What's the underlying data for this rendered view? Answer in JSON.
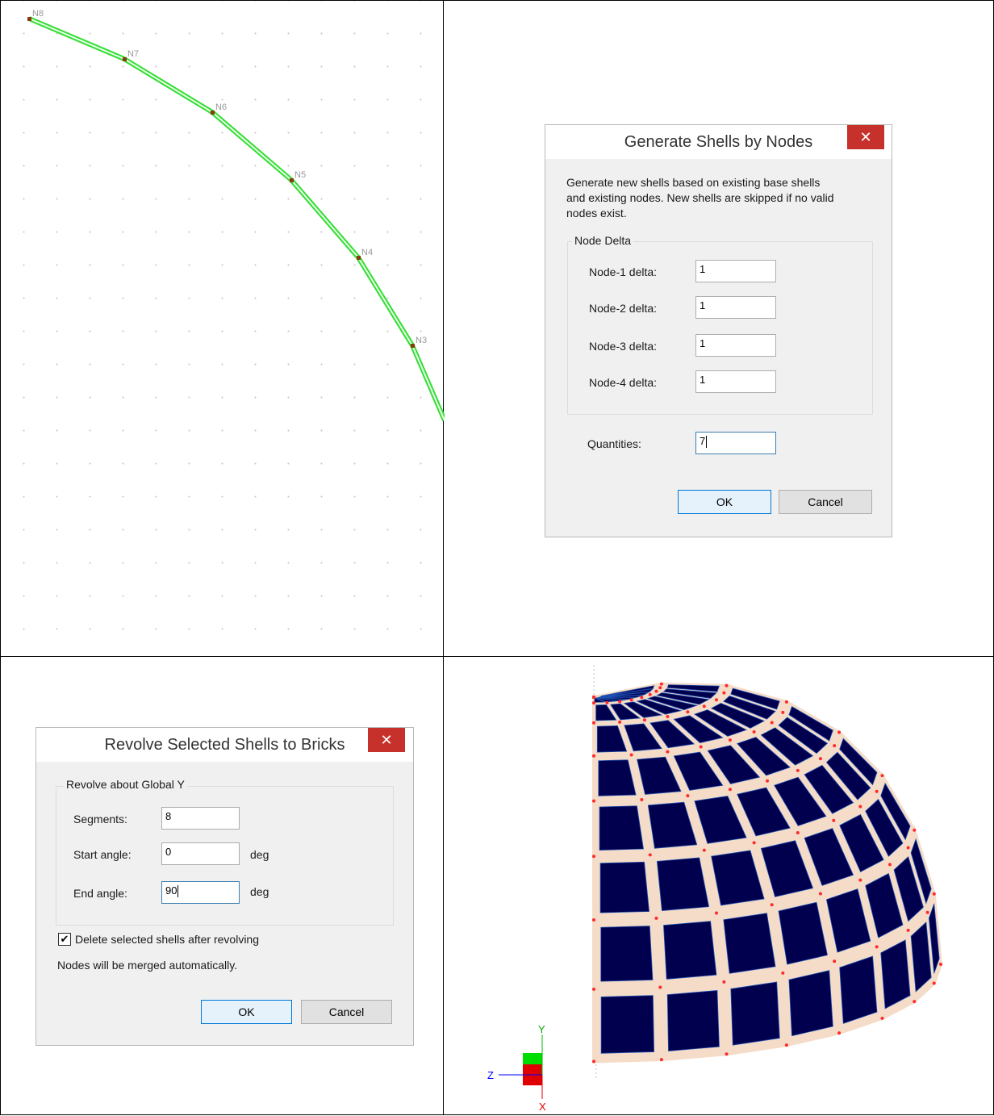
{
  "top_left_view": {
    "nodes": [
      {
        "label": "N8"
      },
      {
        "label": "N7"
      },
      {
        "label": "N6"
      },
      {
        "label": "N5"
      },
      {
        "label": "N4"
      },
      {
        "label": "N3"
      }
    ]
  },
  "generate_dialog": {
    "title": "Generate Shells by Nodes",
    "close_glyph": "✕",
    "description": [
      "Generate new shells based on existing base shells",
      "and existing nodes.  New shells are skipped if no valid",
      "nodes exist."
    ],
    "group_label": "Node Delta",
    "fields": [
      {
        "label": "Node-1 delta:",
        "value": "1"
      },
      {
        "label": "Node-2 delta:",
        "value": "1"
      },
      {
        "label": "Node-3 delta:",
        "value": "1"
      },
      {
        "label": "Node-4 delta:",
        "value": "1"
      }
    ],
    "quantities_label": "Quantities:",
    "quantities_value": "7",
    "ok_label": "OK",
    "cancel_label": "Cancel"
  },
  "revolve_dialog": {
    "title": "Revolve Selected Shells to Bricks",
    "close_glyph": "✕",
    "group_label": "Revolve about Global Y",
    "segments_label": "Segments:",
    "segments_value": "8",
    "start_label": "Start angle:",
    "start_value": "0",
    "start_unit": "deg",
    "end_label": "End angle:",
    "end_value": "90",
    "end_unit": "deg",
    "delete_checked": true,
    "delete_label": "Delete selected shells after revolving",
    "merge_note": "Nodes will be merged automatically.",
    "ok_label": "OK",
    "cancel_label": "Cancel"
  },
  "model_view": {
    "axis_labels": {
      "y": "Y",
      "z": "Z",
      "x": "X"
    },
    "colors": {
      "brick": "#00004f",
      "edge": "#f5dcc8",
      "node": "#ff2a2a",
      "axis_y": "#00cc00",
      "axis_x": "#e00000",
      "axis_z": "#0000ff"
    }
  }
}
